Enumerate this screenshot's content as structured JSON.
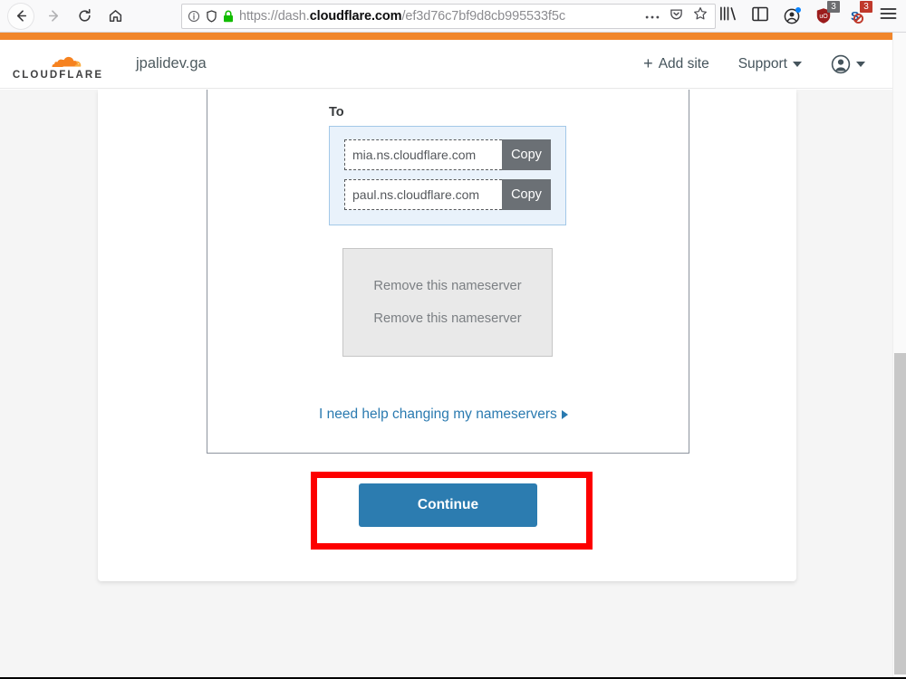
{
  "browser": {
    "nav": {
      "back_icon": "arrow-left-icon",
      "forward_icon": "arrow-right-icon",
      "reload_icon": "reload-icon",
      "home_icon": "home-icon"
    },
    "urlbar": {
      "info_icon": "page-info-icon",
      "shield_icon": "tracking-protection-shield-icon",
      "lock_icon": "padlock-secure-icon",
      "scheme": "https://dash.",
      "host": "cloudflare.com",
      "path": "/ef3d76c7bf9d8cb995533f5c",
      "full_url": "https://dash.cloudflare.com/ef3d76c7bf9d8cb995533f5c",
      "page_actions_icon": "ellipsis-icon",
      "pocket_icon": "pocket-icon",
      "bookmark_icon": "star-bookmark-icon"
    },
    "toolbar_right": {
      "library_icon": "library-icon",
      "sidebar_icon": "sidebar-icon",
      "account_icon": "firefox-account-icon",
      "ublock_icon": "ublock-origin-icon",
      "ublock_badge": "3",
      "scriptsafe_icon": "scriptsafe-icon",
      "scriptsafe_badge": "3",
      "menu_icon": "hamburger-menu-icon"
    }
  },
  "cloudflare_header": {
    "logo_icon": "cloudflare-cloud-logo-icon",
    "wordmark": "CLOUDFLARE",
    "site_name": "jpalidev.ga",
    "add_site_label": "Add site",
    "add_site_plus": "+",
    "support_label": "Support",
    "account_avatar_icon": "user-avatar-icon",
    "caret_icon": "chevron-down-icon"
  },
  "main": {
    "to_label": "To",
    "nameservers": [
      {
        "value": "mia.ns.cloudflare.com",
        "copy_label": "Copy"
      },
      {
        "value": "paul.ns.cloudflare.com",
        "copy_label": "Copy"
      }
    ],
    "remove_links": [
      "Remove this nameserver",
      "Remove this nameserver"
    ],
    "help_link": "I need help changing my nameservers",
    "help_arrow_icon": "caret-right-icon",
    "continue_label": "Continue"
  },
  "annotation": {
    "highlight_color": "#fd0000",
    "target": "continue-button"
  },
  "colors": {
    "cloudflare_orange": "#f1862b",
    "primary_blue": "#2c7cb0",
    "link_blue": "#2a7ab0",
    "panel_blue_bg": "#e9f2fb",
    "copy_button_gray": "#6b7075"
  },
  "scrollbar": {
    "orientation": "vertical",
    "thumb_position": "bottom"
  }
}
